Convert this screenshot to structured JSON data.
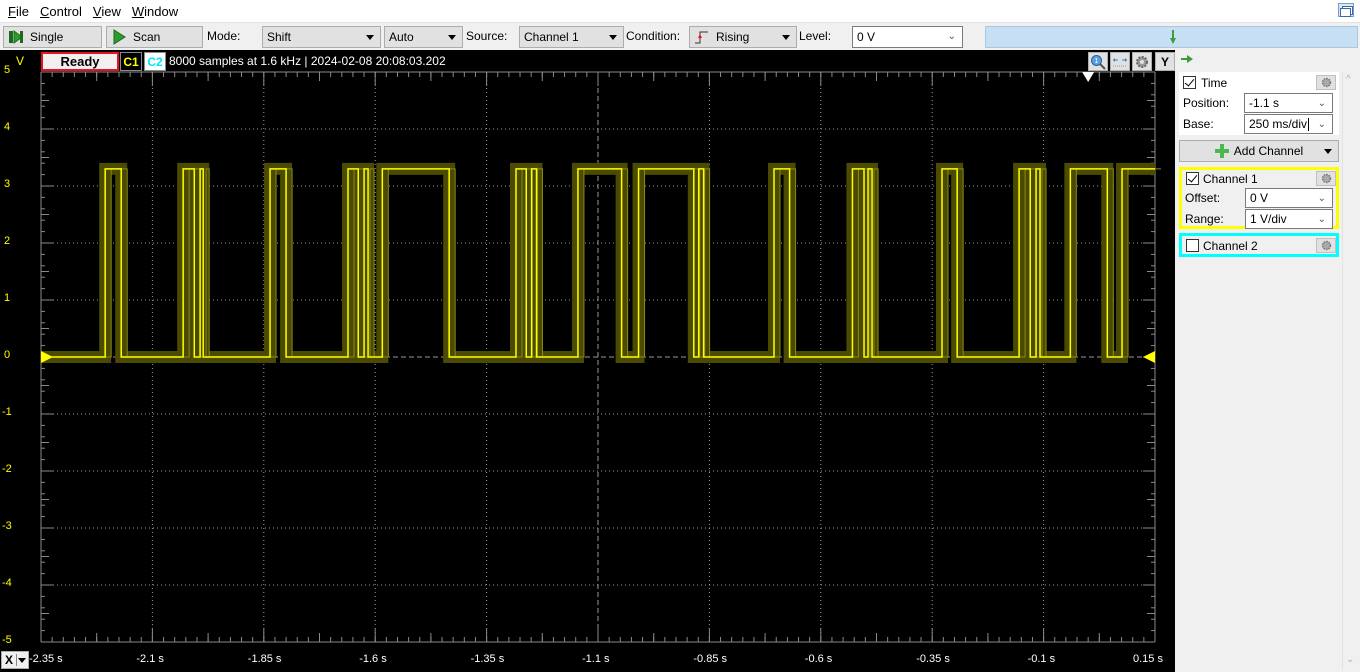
{
  "menu": {
    "items": [
      {
        "label": "File",
        "accel": "F",
        "rest": "ile"
      },
      {
        "label": "Control",
        "accel": "C",
        "rest": "ontrol"
      },
      {
        "label": "View",
        "accel": "V",
        "rest": "iew"
      },
      {
        "label": "Window",
        "accel": "W",
        "rest": "indow"
      }
    ]
  },
  "toolbar": {
    "single_label": "Single",
    "scan_label": "Scan",
    "mode_label": "Mode:",
    "mode_value": "Shift",
    "mode2_value": "Auto",
    "source_label": "Source:",
    "source_value": "Channel 1",
    "condition_label": "Condition:",
    "condition_value": "Rising",
    "level_label": "Level:",
    "level_value": "0 V"
  },
  "scope": {
    "status": "Ready",
    "chip_c1": "C1",
    "chip_c2": "C2",
    "info": "8000 samples at 1.6 kHz | 2024-02-08 20:08:03.202",
    "y_unit": "V",
    "x_button": "X",
    "y_button": "Y",
    "colors": {
      "channel1": "#ffff00",
      "channel2": "#00ffff",
      "status_border": "#e81123"
    }
  },
  "panel": {
    "time": {
      "label": "Time",
      "checked": true,
      "position_label": "Position:",
      "position_value": "-1.1 s",
      "base_label": "Base:",
      "base_value": "250 ms/div"
    },
    "add_channel_label": "Add Channel",
    "channel1": {
      "label": "Channel 1",
      "checked": true,
      "offset_label": "Offset:",
      "offset_value": "0 V",
      "range_label": "Range:",
      "range_value": "1 V/div"
    },
    "channel2": {
      "label": "Channel 2",
      "checked": false
    }
  },
  "chart_data": {
    "type": "line",
    "title": "",
    "xlabel": "",
    "ylabel": "V",
    "xlim": [
      -2.35,
      0.15
    ],
    "ylim": [
      -5,
      5
    ],
    "grid": true,
    "x_ticks": [
      "-2.35 s",
      "-2.1 s",
      "-1.85 s",
      "-1.6 s",
      "-1.35 s",
      "-1.1 s",
      "-0.85 s",
      "-0.6 s",
      "-0.35 s",
      "-0.1 s",
      "0.15 s"
    ],
    "x_tick_values": [
      -2.35,
      -2.1,
      -1.85,
      -1.6,
      -1.35,
      -1.1,
      -0.85,
      -0.6,
      -0.35,
      -0.1,
      0.15
    ],
    "y_ticks": [
      "5",
      "4",
      "3",
      "2",
      "1",
      "0",
      "-1",
      "-2",
      "-3",
      "-4",
      "-5"
    ],
    "y_tick_values": [
      5,
      4,
      3,
      2,
      1,
      0,
      -1,
      -2,
      -3,
      -4,
      -5
    ],
    "trigger_level_v": 0,
    "trigger_time_s": 0,
    "series": [
      {
        "name": "Channel 1",
        "color": "#ffff00",
        "low_v": 0,
        "high_v": 3.3,
        "pulses_s": [
          [
            -2.206,
            -2.17
          ],
          [
            -2.031,
            -2.006
          ],
          [
            -1.993,
            -1.986
          ],
          [
            -1.836,
            -1.8
          ],
          [
            -1.661,
            -1.638
          ],
          [
            -1.625,
            -1.616
          ],
          [
            -1.584,
            -1.434
          ],
          [
            -1.284,
            -1.261
          ],
          [
            -1.249,
            -1.238
          ],
          [
            -1.145,
            -1.047
          ],
          [
            -1.009,
            -0.885
          ],
          [
            -0.874,
            -0.863
          ],
          [
            -0.705,
            -0.67
          ],
          [
            -0.529,
            -0.503
          ],
          [
            -0.494,
            -0.485
          ],
          [
            -0.328,
            -0.294
          ],
          [
            -0.155,
            -0.13
          ],
          [
            -0.117,
            -0.108
          ],
          [
            -0.04,
            0.043
          ],
          [
            0.076,
            0.15
          ]
        ]
      }
    ]
  }
}
